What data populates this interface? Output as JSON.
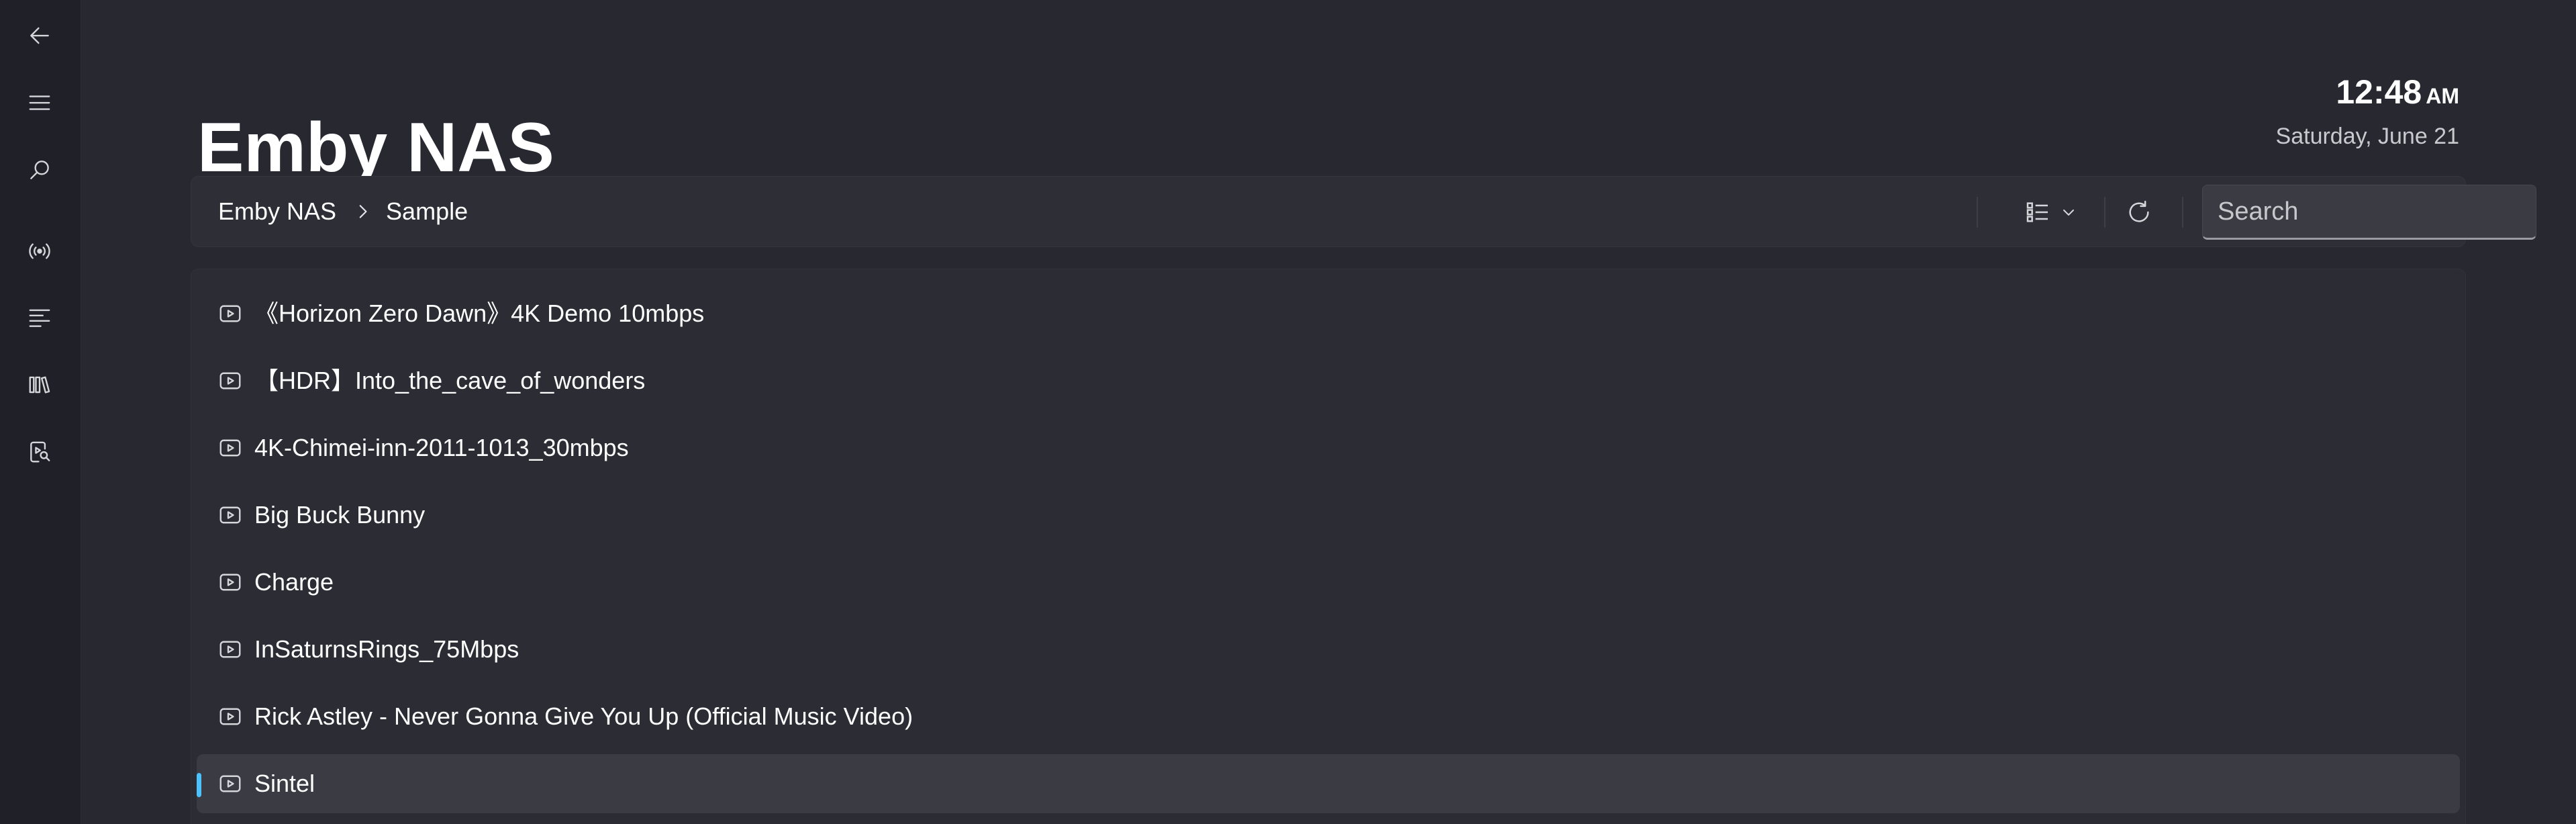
{
  "app": {
    "title": "Emby NAS"
  },
  "clock": {
    "time": "12:48",
    "ampm": "AM",
    "date": "Saturday, June 21"
  },
  "nav_rail": [
    {
      "name": "back-icon"
    },
    {
      "name": "hamburger-menu-icon"
    },
    {
      "name": "search-icon"
    },
    {
      "name": "broadcast-icon"
    },
    {
      "name": "playlist-icon"
    },
    {
      "name": "library-icon"
    },
    {
      "name": "video-search-icon"
    }
  ],
  "breadcrumb": {
    "items": [
      "Emby NAS",
      "Sample"
    ]
  },
  "toolbar": {
    "view_icon": "list-view-icon",
    "refresh_icon": "refresh-icon"
  },
  "search": {
    "placeholder": "Search",
    "value": ""
  },
  "files": {
    "items": [
      {
        "label": "《Horizon Zero Dawn》4K Demo 10mbps",
        "icon": "video-file-icon",
        "selected": false
      },
      {
        "label": "【HDR】Into_the_cave_of_wonders",
        "icon": "video-file-icon",
        "selected": false
      },
      {
        "label": "4K-Chimei-inn-2011-1013_30mbps",
        "icon": "video-file-icon",
        "selected": false
      },
      {
        "label": "Big Buck Bunny",
        "icon": "video-file-icon",
        "selected": false
      },
      {
        "label": "Charge",
        "icon": "video-file-icon",
        "selected": false
      },
      {
        "label": "InSaturnsRings_75Mbps",
        "icon": "video-file-icon",
        "selected": false
      },
      {
        "label": "Rick Astley - Never Gonna Give You Up (Official Music Video)",
        "icon": "video-file-icon",
        "selected": false
      },
      {
        "label": "Sintel",
        "icon": "video-file-icon",
        "selected": true
      }
    ]
  },
  "colors": {
    "accent": "#4cc2ff",
    "background": "#272830",
    "rail": "#1f2028",
    "selected_row": "#3a3b43"
  }
}
